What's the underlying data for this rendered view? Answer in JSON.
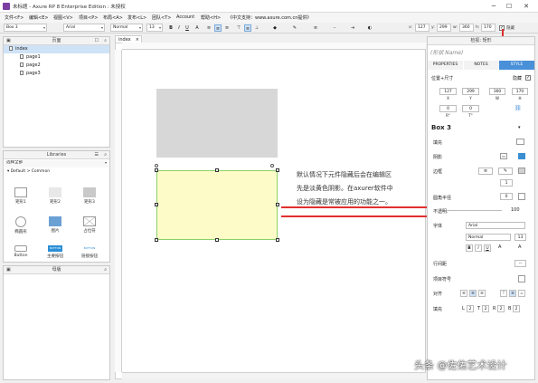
{
  "window": {
    "title": "未标题 - Axure RP 8 Enterprise Edition : 未授权",
    "min": "─",
    "max": "☐",
    "close": "✕"
  },
  "menu": {
    "items": [
      "文件<F>",
      "编辑<E>",
      "视图<V>",
      "项目<P>",
      "布局<A>",
      "发布<L>",
      "团队<T>",
      "Account",
      "帮助<H>"
    ],
    "notice": "《中文支持：www.axure.com.cn提供》"
  },
  "toolbar": {
    "element_select": "Box 3",
    "font_family": "Arial",
    "font_style": "Normal",
    "font_size": "13",
    "x": "127",
    "y": "299",
    "w": "360",
    "h": "170",
    "hidden_label": "隐藏",
    "x_label": "x:",
    "y_label": "y:",
    "w_label": "w:",
    "h_label": "h:"
  },
  "pages_panel": {
    "title": "页面",
    "root": "index",
    "children": [
      "page1",
      "page2",
      "page3"
    ]
  },
  "libraries_panel": {
    "title": "Libraries",
    "select_all": "选择全部",
    "section": "Default > Common",
    "items": [
      {
        "label": "矩形1",
        "icon": "rectangle-icon"
      },
      {
        "label": "矩形2",
        "icon": "rectangle-gray-icon"
      },
      {
        "label": "矩形3",
        "icon": "rectangle-dark-icon"
      },
      {
        "label": "椭圆形",
        "icon": "ellipse-icon"
      },
      {
        "label": "图片",
        "icon": "image-icon"
      },
      {
        "label": "占位符",
        "icon": "placeholder-icon"
      },
      {
        "label": "Button",
        "icon": "button-icon"
      },
      {
        "label": "主要按钮",
        "icon": "primary-button-icon"
      },
      {
        "label": "链接按钮",
        "icon": "link-button-icon"
      }
    ],
    "button_text": "BUTTON",
    "link_text": "BUTTON"
  },
  "masters_panel": {
    "title": "母版"
  },
  "canvas": {
    "tab": "index",
    "annotation": [
      "默认情况下元件隐藏后会在编辑区",
      "先是淡黄色阴影。在axurer软件中",
      "设为隐藏是常被应用的功能之一。"
    ],
    "watermark": "头条 @佐佑艺术设计"
  },
  "inspector": {
    "header": "检视: 矩形",
    "shape_name_placeholder": "(形状 Name)",
    "tabs": [
      "PROPERTIES",
      "NOTES",
      "STYLE"
    ],
    "active_tab": "STYLE",
    "position_size_label": "位置+尺寸",
    "hidden_label": "隐藏",
    "pos": [
      {
        "value": "127",
        "label": "X"
      },
      {
        "value": "299",
        "label": "Y"
      },
      {
        "value": "360",
        "label": "W"
      },
      {
        "value": "170",
        "label": "H"
      }
    ],
    "rot": [
      {
        "value": "0",
        "label": "R°"
      },
      {
        "value": "0",
        "label": "T°"
      }
    ],
    "style_select": "Box 3",
    "fill_label": "填充",
    "shadow_label": "阴影",
    "border_label": "边框",
    "border_value": "1",
    "corner_label": "圆角半径",
    "corner_value": "0",
    "opacity_label": "不透明:",
    "opacity_value": "100",
    "font_label": "字体",
    "font_value": "Arial",
    "font_style": "Normal",
    "font_size": "13",
    "line_height_label": "行间距",
    "line_height_value": "--",
    "bullet_label": "项目符号",
    "align_label": "对齐",
    "padding_label": "填充",
    "padding": [
      {
        "label": "L",
        "value": "2"
      },
      {
        "label": "T",
        "value": "2"
      },
      {
        "label": "R",
        "value": "2"
      },
      {
        "label": "B",
        "value": "2"
      }
    ],
    "bold": "B",
    "italic": "I",
    "underline": "U"
  },
  "colors": {
    "accent": "#7a3fa0",
    "selected_tab": "#4a90d9",
    "hidden_fill": "#fdfbc8",
    "hidden_border": "#8bd16a",
    "gray_box": "#d7d7d7",
    "callout": "#e0302e"
  }
}
